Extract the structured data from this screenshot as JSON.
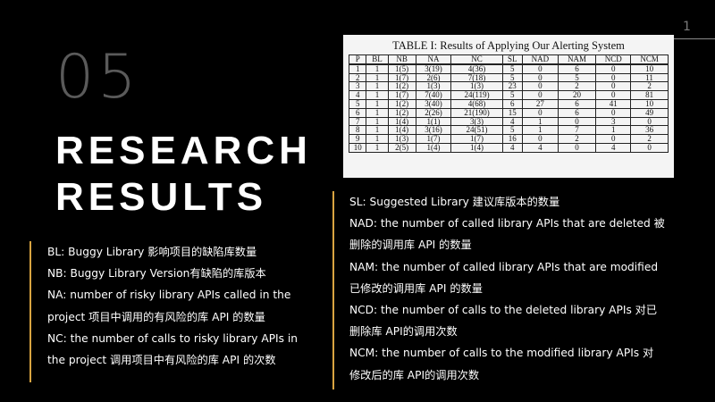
{
  "slide": {
    "number": "1",
    "section_number": "05",
    "title_line1": "RESEARCH",
    "title_line2": "RESULTS"
  },
  "table": {
    "caption": "TABLE I: Results of Applying Our Alerting System",
    "headers": [
      "P",
      "BL",
      "NB",
      "NA",
      "NC",
      "SL",
      "NAD",
      "NAM",
      "NCD",
      "NCM"
    ],
    "rows": [
      [
        "1",
        "1",
        "1(5)",
        "3(19)",
        "4(36)",
        "5",
        "0",
        "6",
        "0",
        "10"
      ],
      [
        "2",
        "1",
        "1(7)",
        "2(6)",
        "7(18)",
        "5",
        "0",
        "5",
        "0",
        "11"
      ],
      [
        "3",
        "1",
        "1(2)",
        "1(3)",
        "1(3)",
        "23",
        "0",
        "2",
        "0",
        "2"
      ],
      [
        "4",
        "1",
        "1(7)",
        "7(40)",
        "24(119)",
        "5",
        "0",
        "20",
        "0",
        "81"
      ],
      [
        "5",
        "1",
        "1(2)",
        "3(40)",
        "4(68)",
        "6",
        "27",
        "6",
        "41",
        "10"
      ],
      [
        "6",
        "1",
        "1(2)",
        "2(26)",
        "21(190)",
        "15",
        "0",
        "6",
        "0",
        "49"
      ],
      [
        "7",
        "1",
        "1(4)",
        "1(1)",
        "3(3)",
        "4",
        "1",
        "0",
        "3",
        "0"
      ],
      [
        "8",
        "1",
        "1(4)",
        "3(16)",
        "24(51)",
        "5",
        "1",
        "7",
        "1",
        "36"
      ],
      [
        "9",
        "1",
        "1(3)",
        "1(7)",
        "1(7)",
        "16",
        "0",
        "2",
        "0",
        "2"
      ],
      [
        "10",
        "1",
        "2(5)",
        "1(4)",
        "1(4)",
        "4",
        "4",
        "0",
        "4",
        "0"
      ]
    ]
  },
  "legend_left": [
    "BL: Buggy Library 影响项目的缺陷库数量",
    "NB: Buggy Library Version有缺陷的库版本",
    "NA: number of risky library APIs called in the",
    "project 项目中调用的有风险的库 API 的数量",
    "NC: the number of calls to risky library APIs in",
    "the project 调用项目中有风险的库 API 的次数"
  ],
  "legend_right": [
    "SL: Suggested Library 建议库版本的数量",
    "NAD:  the number of called library APIs that are deleted 被",
    "删除的调用库 API 的数量",
    "NAM: the number of called library APIs that are modified",
    "已修改的调用库 API 的数量",
    "NCD:  the number of calls to the deleted library APIs 对已",
    "删除库 API的调用次数",
    "NCM:  the number of calls to the modified library APIs  对",
    "修改后的库 API的调用次数"
  ]
}
